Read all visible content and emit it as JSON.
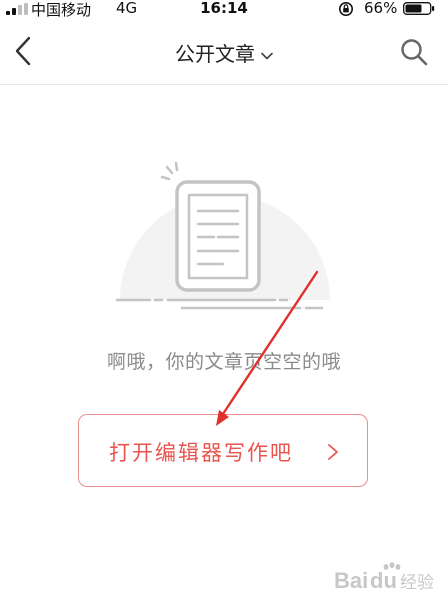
{
  "status_bar": {
    "carrier": "中国移动",
    "network": "4G",
    "time": "16:14",
    "battery_percent": "66%"
  },
  "nav": {
    "title": "公开文章"
  },
  "empty_state": {
    "message": "啊哦，你的文章页空空的哦",
    "button_label": "打开编辑器写作吧"
  },
  "watermark": {
    "text": "Baidu经验"
  },
  "colors": {
    "accent": "#e8554f",
    "button_border": "#ec8e8c",
    "muted_text": "#8a8a8a",
    "illustration_gray": "#c4c4c4",
    "illustration_bg": "#f3f3f3",
    "annotation_red": "#e0302a"
  }
}
